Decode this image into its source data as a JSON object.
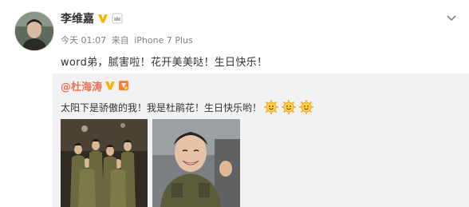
{
  "post": {
    "author": "李维嘉",
    "meta": {
      "time": "今天 01:07",
      "source_prefix": "来自",
      "source": "iPhone 7 Plus"
    },
    "text": "word弟，腻害啦！花开美美哒！生日快乐！"
  },
  "repost": {
    "author": "@杜海涛",
    "text": "太阳下是骄傲的我！我是杜鹃花！生日快乐哟！"
  },
  "colors": {
    "accent": "#eb7350",
    "verified": "#f7b500",
    "repost_bg": "#f2f2f5"
  },
  "icons": [
    "verified-v-icon",
    "crown-icon",
    "chevron-down-icon",
    "member-icon",
    "sun-emoji-icon"
  ]
}
